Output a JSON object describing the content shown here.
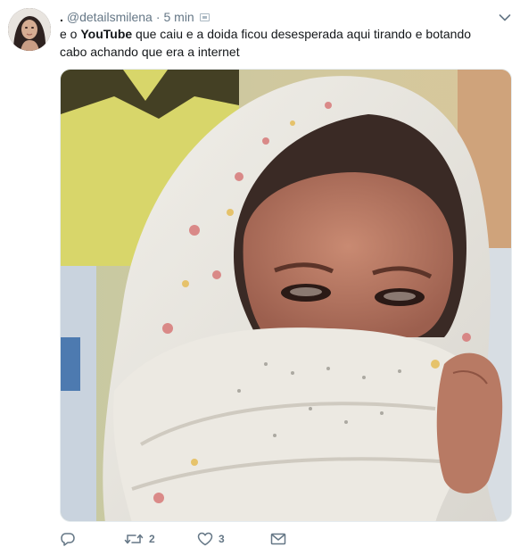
{
  "tweet": {
    "display_name": ".",
    "handle": "@detailsmilena",
    "separator": "·",
    "time": "5 min",
    "text_parts": {
      "before": "e o ",
      "bold": "YouTube",
      "after": " que caiu e a doida ficou desesperada aqui tirando e botando cabo achando que era a internet"
    },
    "actions": {
      "reply_count": "",
      "retweet_count": "2",
      "like_count": "3"
    }
  },
  "icons": {
    "avatar": "avatar",
    "caret": "chevron-down-icon",
    "reply": "reply-icon",
    "retweet": "retweet-icon",
    "like": "heart-icon",
    "dm": "envelope-icon"
  },
  "colors": {
    "text": "#14171a",
    "muted": "#657786",
    "border": "#e6ecf0"
  }
}
